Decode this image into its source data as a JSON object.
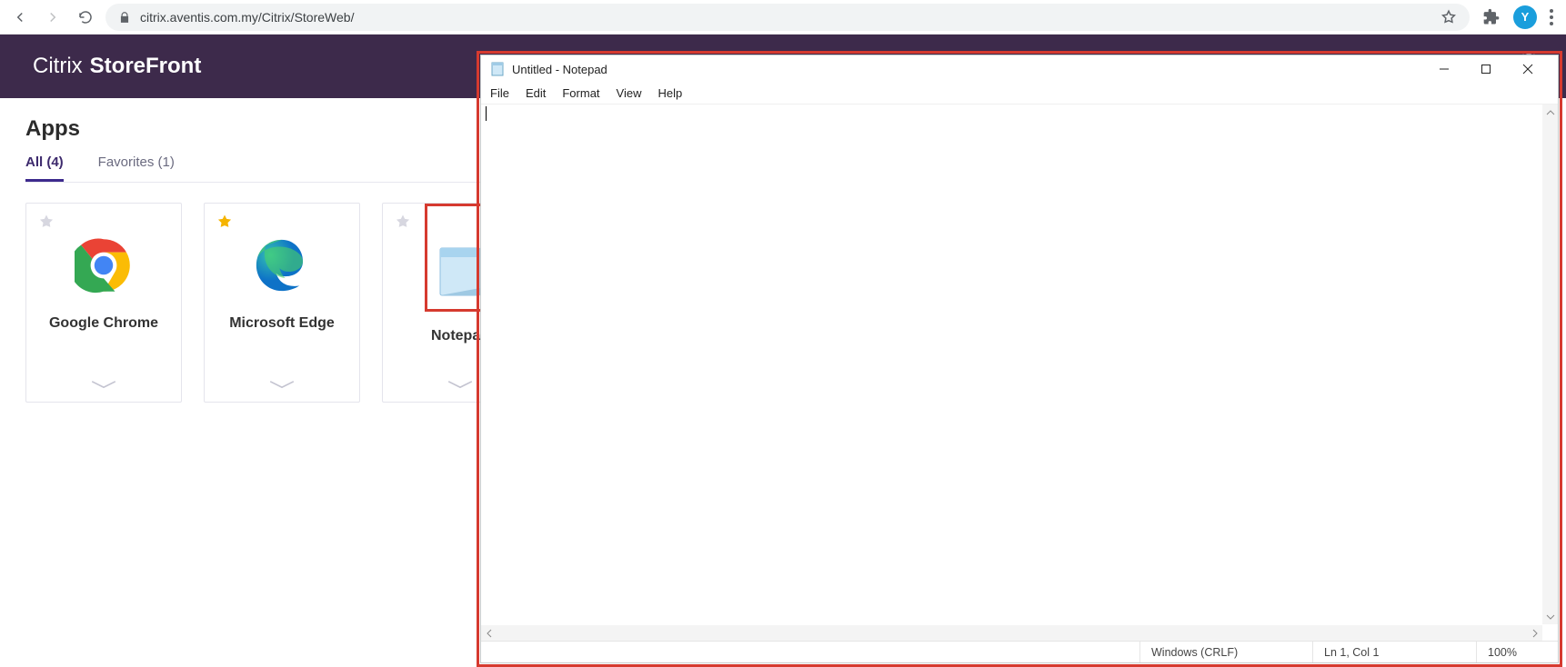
{
  "browser": {
    "url": "citrix.aventis.com.my/Citrix/StoreWeb/",
    "avatar_letter": "Y"
  },
  "citrix": {
    "brand_light": "Citrix",
    "brand_bold": "StoreFront",
    "apps_heading": "Apps",
    "tabs": {
      "all": "All (4)",
      "favorites": "Favorites (1)"
    },
    "apps": [
      {
        "name": "Google Chrome",
        "favorite": false
      },
      {
        "name": "Microsoft Edge",
        "favorite": true
      },
      {
        "name": "Notepad",
        "favorite": false
      }
    ]
  },
  "notepad": {
    "title": "Untitled - Notepad",
    "menu": {
      "file": "File",
      "edit": "Edit",
      "format": "Format",
      "view": "View",
      "help": "Help"
    },
    "status": {
      "encoding_mode": "Windows (CRLF)",
      "position": "Ln 1, Col 1",
      "zoom": "100%"
    },
    "content": ""
  }
}
